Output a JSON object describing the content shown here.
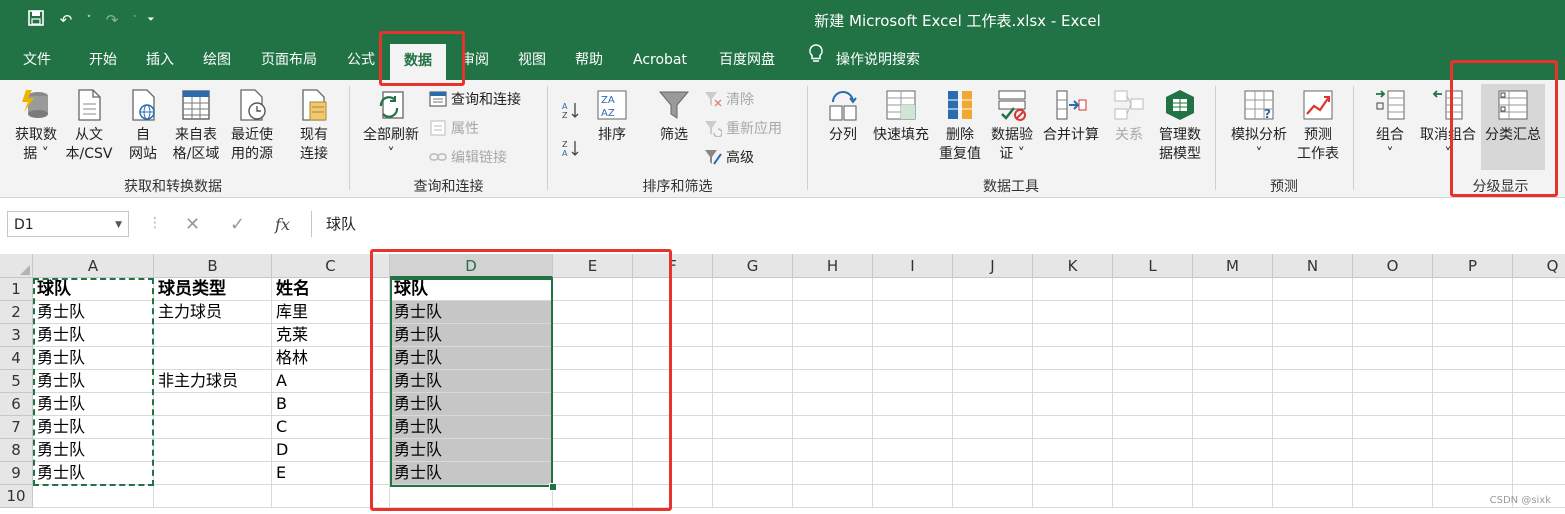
{
  "window": {
    "title": "新建 Microsoft Excel 工作表.xlsx  -  Excel"
  },
  "tabs": [
    "文件",
    "开始",
    "插入",
    "绘图",
    "页面布局",
    "公式",
    "数据",
    "审阅",
    "视图",
    "帮助",
    "Acrobat",
    "百度网盘"
  ],
  "active_tab": "数据",
  "tell_me": "操作说明搜索",
  "ribbon": {
    "get_data": {
      "label_1": "获取数",
      "label_2": "据 ˅"
    },
    "from_csv": {
      "label_1": "从文",
      "label_2": "本/CSV"
    },
    "from_web": {
      "label_1": "自",
      "label_2": "网站"
    },
    "from_table": {
      "label_1": "来自表",
      "label_2": "格/区域"
    },
    "recent_sources": {
      "label_1": "最近使",
      "label_2": "用的源"
    },
    "existing_conn": {
      "label_1": "现有",
      "label_2": "连接"
    },
    "group_get_transform": "获取和转换数据",
    "refresh_all": {
      "label_1": "全部刷新",
      "label_2": "˅"
    },
    "queries_conn": "查询和连接",
    "properties": "属性",
    "edit_links": "编辑链接",
    "group_queries": "查询和连接",
    "sort": "排序",
    "filter": "筛选",
    "clear": "清除",
    "reapply": "重新应用",
    "advanced": "高级",
    "group_sort_filter": "排序和筛选",
    "text_to_columns": "分列",
    "flash_fill": "快速填充",
    "remove_dup": {
      "label_1": "删除",
      "label_2": "重复值"
    },
    "validation": {
      "label_1": "数据验",
      "label_2": "证 ˅"
    },
    "consolidate": "合并计算",
    "relationships": "关系",
    "data_model": {
      "label_1": "管理数",
      "label_2": "据模型"
    },
    "group_data_tools": "数据工具",
    "whatif": {
      "label_1": "模拟分析",
      "label_2": "˅"
    },
    "forecast_sheet": {
      "label_1": "预测",
      "label_2": "工作表"
    },
    "group_forecast": "预测",
    "group": {
      "label_1": "组合",
      "label_2": "˅"
    },
    "ungroup": {
      "label_1": "取消组合",
      "label_2": "˅"
    },
    "subtotal": "分类汇总",
    "group_outline": "分级显示"
  },
  "formula_bar": {
    "name_box": "D1",
    "content": "球队"
  },
  "columns": [
    "A",
    "B",
    "C",
    "D",
    "E",
    "F",
    "G",
    "H",
    "I",
    "J",
    "K",
    "L",
    "M",
    "N",
    "O",
    "P",
    "Q"
  ],
  "rows": [
    "1",
    "2",
    "3",
    "4",
    "5",
    "6",
    "7",
    "8",
    "9",
    "10"
  ],
  "sheet": {
    "A": [
      "球队",
      "勇士队",
      "勇士队",
      "勇士队",
      "勇士队",
      "勇士队",
      "勇士队",
      "勇士队",
      "勇士队"
    ],
    "B": [
      "球员类型",
      "主力球员",
      "",
      "",
      "非主力球员",
      "",
      "",
      "",
      ""
    ],
    "C": [
      "姓名",
      "库里",
      "克莱",
      "格林",
      "A",
      "B",
      "C",
      "D",
      "E"
    ],
    "D": [
      "球队",
      "勇士队",
      "勇士队",
      "勇士队",
      "勇士队",
      "勇士队",
      "勇士队",
      "勇士队",
      "勇士队"
    ]
  },
  "selected_cell": "D1",
  "watermark": "CSDN @sixk",
  "colors": {
    "excel_green": "#217346",
    "annotation_red": "#e8322c"
  }
}
